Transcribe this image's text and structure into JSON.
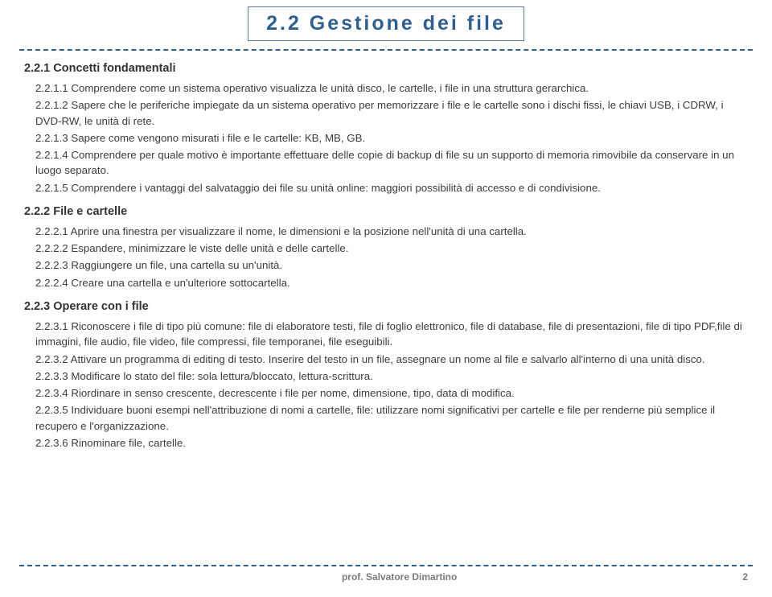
{
  "title": "2.2 Gestione dei file",
  "sections": [
    {
      "heading": "2.2.1 Concetti fondamentali",
      "items": [
        "2.2.1.1 Comprendere come un sistema operativo visualizza le unità disco, le cartelle, i file in una struttura gerarchica.",
        "2.2.1.2 Sapere che le periferiche impiegate da un sistema operativo per memorizzare i file e le cartelle sono i dischi fissi, le chiavi USB, i CDRW, i DVD-RW, le unità di rete.",
        "2.2.1.3 Sapere come vengono misurati i file e le cartelle: KB, MB, GB.",
        "2.2.1.4 Comprendere per quale motivo è importante effettuare delle copie di backup di file su un supporto di memoria rimovibile da conservare in un luogo separato.",
        "2.2.1.5 Comprendere i vantaggi del salvataggio dei file su unità online: maggiori possibilità di accesso e di condivisione."
      ]
    },
    {
      "heading": "2.2.2 File e cartelle",
      "items": [
        "2.2.2.1 Aprire una finestra per visualizzare il nome, le dimensioni e la posizione nell'unità di una cartella.",
        "2.2.2.2 Espandere, minimizzare le viste delle unità e delle cartelle.",
        "2.2.2.3 Raggiungere un file, una cartella su un'unità.",
        "2.2.2.4 Creare una cartella e un'ulteriore sottocartella."
      ]
    },
    {
      "heading": "2.2.3 Operare con i file",
      "items": [
        "2.2.3.1 Riconoscere i file di tipo più comune: file di elaboratore testi, file di foglio elettronico, file di database, file di presentazioni, file di tipo PDF,file di immagini, file audio, file video, file compressi, file temporanei, file eseguibili.",
        "2.2.3.2 Attivare un programma di editing di testo. Inserire del testo in un file, assegnare un nome al file e salvarlo all'interno di una unità disco.",
        "2.2.3.3 Modificare lo stato del file: sola lettura/bloccato, lettura-scrittura.",
        "2.2.3.4 Riordinare in senso crescente, decrescente i file per nome, dimensione, tipo, data di modifica.",
        "2.2.3.5 Individuare buoni esempi nell'attribuzione di nomi a cartelle, file: utilizzare nomi significativi per cartelle e file per renderne più semplice il recupero e l'organizzazione.",
        "2.2.3.6 Rinominare file, cartelle."
      ]
    }
  ],
  "footer": {
    "author": "prof. Salvatore Dimartino",
    "page": "2"
  }
}
